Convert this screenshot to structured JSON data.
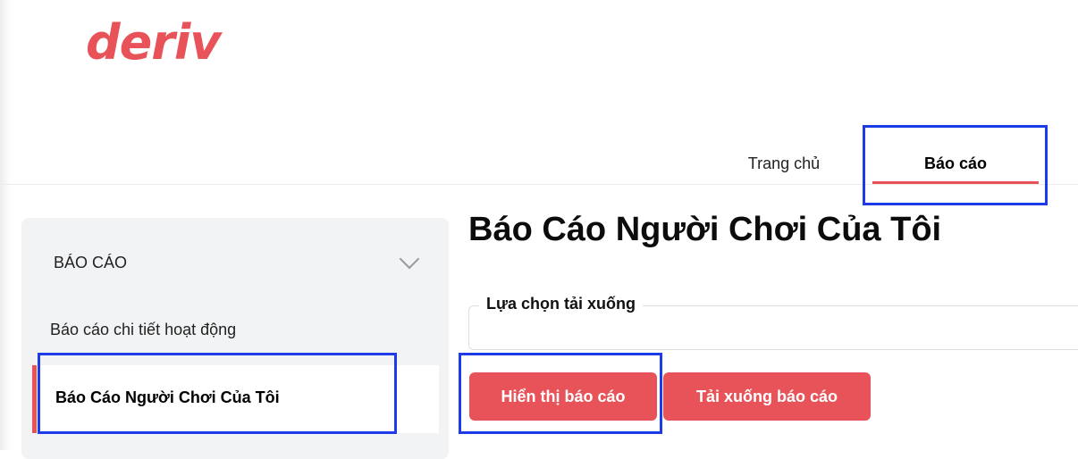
{
  "brand": {
    "logo_text": "deriv",
    "color": "#e8535a"
  },
  "nav": {
    "home_label": "Trang chủ",
    "reports_label": "Báo cáo"
  },
  "sidebar": {
    "section_label": "BÁO CÁO",
    "items": [
      {
        "label": "Báo cáo chi tiết hoạt động",
        "active": false
      },
      {
        "label": "Báo Cáo Người Chơi Của Tôi",
        "active": true
      }
    ]
  },
  "main": {
    "title": "Báo Cáo Người Chơi Của Tôi",
    "download_options_label": "Lựa chọn tải xuống",
    "show_report_label": "Hiển thị báo cáo",
    "download_report_label": "Tải xuống báo cáo"
  },
  "colors": {
    "accent": "#e8535a",
    "highlight": "#1d3ce8"
  }
}
